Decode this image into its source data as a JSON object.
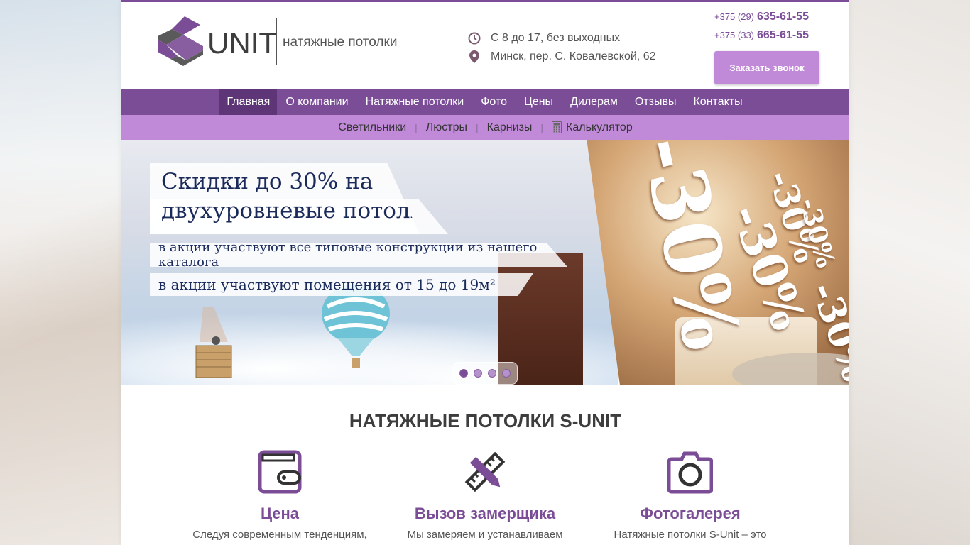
{
  "header": {
    "logo_word": "UNIT",
    "logo_tagline": "натяжные потолки",
    "hours": "С 8 до 17, без выходных",
    "address": "Минск, пер. С. Ковалевской, 62",
    "phones": [
      {
        "prefix": "+375 (29)",
        "number": "635-61-55"
      },
      {
        "prefix": "+375 (33)",
        "number": "665-61-55"
      }
    ],
    "callback_label": "Заказать звонок"
  },
  "nav_main": [
    "Главная",
    "О компании",
    "Натяжные потолки",
    "Фото",
    "Цены",
    "Дилерам",
    "Отзывы",
    "Контакты"
  ],
  "nav_sub": [
    "Светильники",
    "Люстры",
    "Карнизы",
    "Калькулятор"
  ],
  "separator": "|",
  "banner": {
    "title_line1": "Скидки до 30% на",
    "title_line2": "двухуровневые потолки",
    "line1": "в акции участвуют все типовые конструкции из нашего каталога",
    "line2": "в акции участвуют помещения от 15 до 19м²",
    "percent_text": "-30%",
    "slides": 4,
    "active_slide": 1
  },
  "content": {
    "title": "НАТЯЖНЫЕ ПОТОЛКИ S-UNIT",
    "features": [
      {
        "icon": "wallet-icon",
        "name": "Цена",
        "desc": "Следуя современным тенденциям,"
      },
      {
        "icon": "ruler-pencil-icon",
        "name": "Вызов замерщика",
        "desc": "Мы замеряем и устанавливаем"
      },
      {
        "icon": "camera-icon",
        "name": "Фотогалерея",
        "desc": "Натяжные потолки S-Unit – это"
      }
    ]
  },
  "colors": {
    "brand_purple": "#7b4d96",
    "brand_light_purple": "#c08ad8",
    "nav_active": "#5e3577"
  }
}
